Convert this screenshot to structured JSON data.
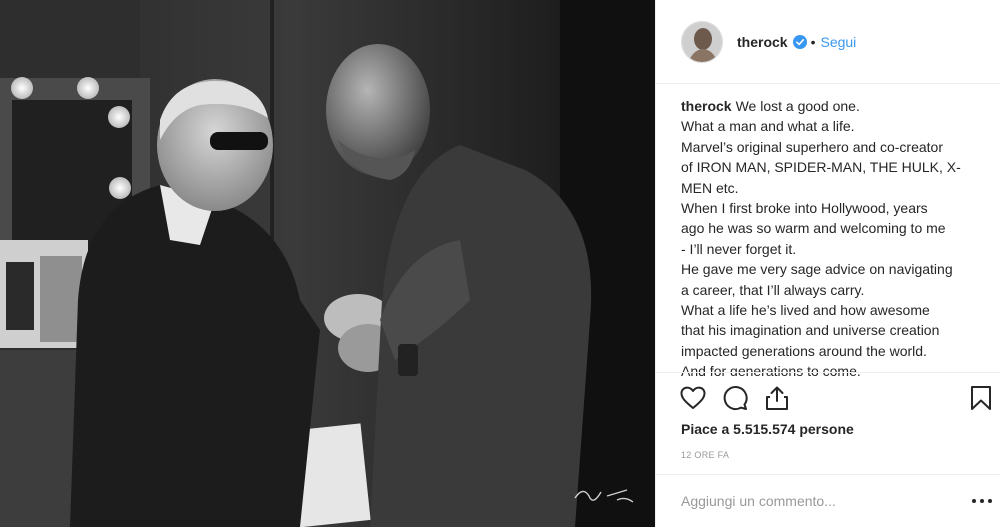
{
  "post": {
    "username": "therock",
    "separator": "•",
    "follow_label": "Segui",
    "caption_author": "therock",
    "caption_lines": [
      "We lost a good one.",
      "What a man and what a life.",
      "Marvel’s original superhero and co-creator",
      "of IRON MAN, SPIDER-MAN, THE HULK, X-",
      "MEN etc.",
      "When I first broke into Hollywood, years",
      "ago he was so warm and welcoming to me",
      "- I’ll never forget it.",
      "He gave me very sage advice on navigating",
      "a career, that I’ll always carry.",
      "What a life he’s lived and how awesome",
      "that his imagination and universe creation",
      "impacted generations around the world.",
      "And for generations to come."
    ],
    "likes_text": "Piace a 5.515.574 persone",
    "timestamp": "12 ORE FA",
    "comment_placeholder": "Aggiungi un commento..."
  },
  "icons": {
    "verified": "verified-badge-icon",
    "like": "heart-icon",
    "comment": "comment-icon",
    "share": "share-icon",
    "save": "bookmark-icon",
    "more": "more-options-icon"
  },
  "colors": {
    "link_blue": "#3897f0",
    "text": "#262626",
    "muted": "#999999",
    "border": "#efefef"
  }
}
